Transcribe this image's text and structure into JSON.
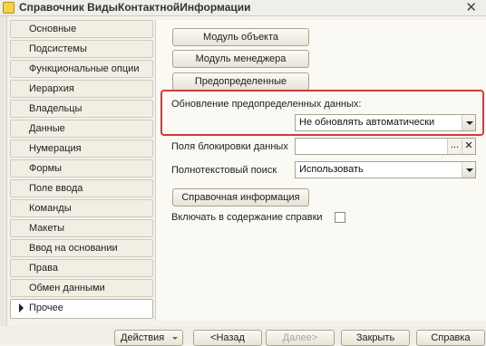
{
  "window": {
    "title": "Справочник ВидыКонтактнойИнформации",
    "close_glyph": "✕"
  },
  "tabs": [
    {
      "label": "Основные"
    },
    {
      "label": "Подсистемы"
    },
    {
      "label": "Функциональные опции"
    },
    {
      "label": "Иерархия"
    },
    {
      "label": "Владельцы"
    },
    {
      "label": "Данные"
    },
    {
      "label": "Нумерация"
    },
    {
      "label": "Формы"
    },
    {
      "label": "Поле ввода"
    },
    {
      "label": "Команды"
    },
    {
      "label": "Макеты"
    },
    {
      "label": "Ввод на основании"
    },
    {
      "label": "Права"
    },
    {
      "label": "Обмен данными"
    },
    {
      "label": "Прочее",
      "active": true
    }
  ],
  "other": {
    "object_module_button": "Модуль объекта",
    "manager_module_button": "Модуль менеджера",
    "predefined_button": "Предопределенные",
    "predefined_update": {
      "label": "Обновление предопределенных данных:",
      "value": "Не обновлять автоматически"
    },
    "data_lock_fields": {
      "label": "Поля блокировки данных",
      "value": "",
      "dots": "...",
      "clear": "✕"
    },
    "fulltext_search": {
      "label": "Полнотекстовый поиск",
      "value": "Использовать"
    },
    "help_button": "Справочная информация",
    "include_in_help": {
      "label": "Включать в содержание справки",
      "checked": false
    }
  },
  "bottom": {
    "actions_button": "Действия",
    "back_button": "<Назад",
    "next_button": "Далее>",
    "close_button": "Закрыть",
    "help_button": "Справка"
  },
  "colors": {
    "highlight": "#d23b3b"
  }
}
